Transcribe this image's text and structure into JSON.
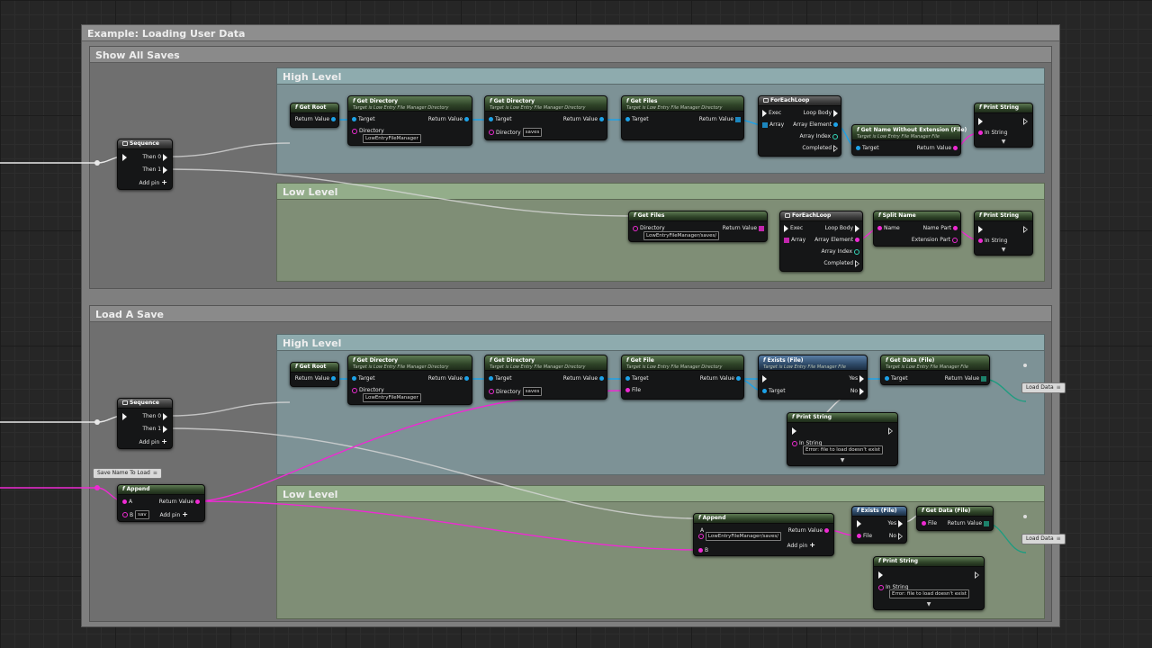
{
  "comments": {
    "outer": "Example: Loading User Data",
    "show_all": "Show All Saves",
    "load_a_save": "Load A Save",
    "high_level": "High Level",
    "low_level": "Low Level"
  },
  "common": {
    "target_is_dir": "Target is Low Entry File Manager Directory",
    "target_is_file": "Target is Low Entry File Manager File",
    "get_root": "Get Root",
    "get_directory": "Get Directory",
    "get_files": "Get Files",
    "get_file": "Get File",
    "foreach": "ForEachLoop",
    "get_name_wo_ext": "Get Name Without Extension (File)",
    "print_string": "Print String",
    "split_name": "Split Name",
    "sequence": "Sequence",
    "exists": "Exists (File)",
    "get_data": "Get Data (File)",
    "append": "Append",
    "return_value": "Return Value",
    "target": "Target",
    "directory": "Directory",
    "file": "File",
    "exec": "Exec",
    "array": "Array",
    "loop_body": "Loop Body",
    "array_element": "Array Element",
    "array_index": "Array Index",
    "completed": "Completed",
    "in_string": "In String",
    "then0": "Then 0",
    "then1": "Then 1",
    "add_pin": "Add pin",
    "name": "Name",
    "name_part": "Name Part",
    "extension_part": "Extension Part",
    "yes": "Yes",
    "no": "No",
    "a": "A",
    "b": "B",
    "caret": "▼"
  },
  "values": {
    "lefm": "LowEntryFileManager",
    "saves": "saves",
    "lefm_saves": "LowEntryFileManager/saves/",
    "sav": "sav",
    "error_msg": "Error: file to load doesn't exist"
  },
  "variables": {
    "load_data": "Load Data",
    "save_name_to_load": "Save Name To Load",
    "var_icon": "≡"
  }
}
